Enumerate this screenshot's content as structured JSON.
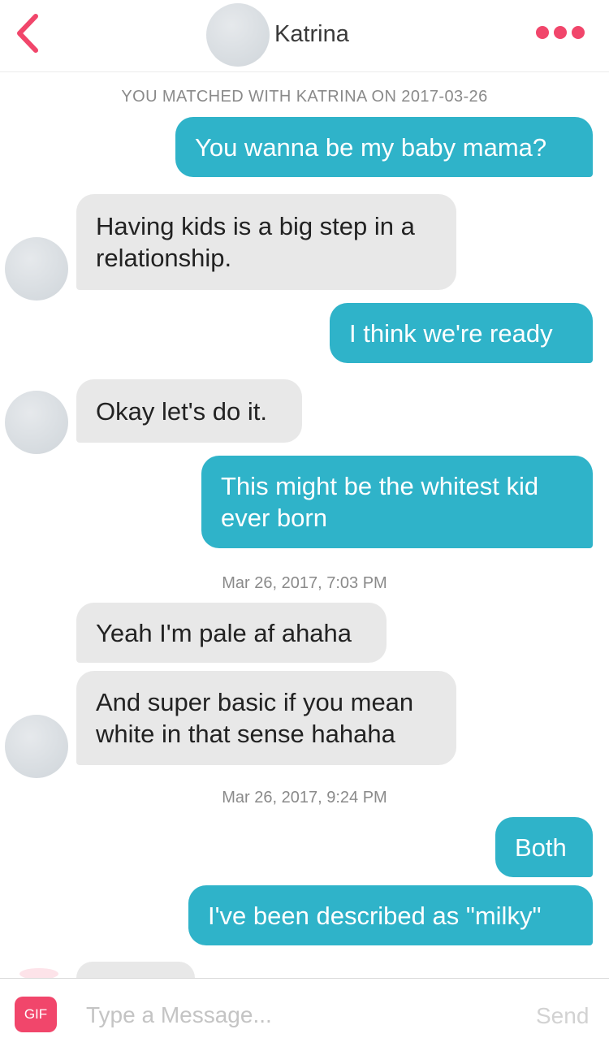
{
  "header": {
    "name": "Katrina"
  },
  "match_note": "YOU MATCHED WITH KATRINA ON 2017-03-26",
  "messages": [
    {
      "from": "me",
      "text": "You wanna be my baby mama?"
    },
    {
      "from": "them",
      "text": "Having kids is a big step in a relationship."
    },
    {
      "from": "me",
      "text": "I think we're ready"
    },
    {
      "from": "them",
      "text": "Okay let's do it."
    },
    {
      "from": "me",
      "text": "This might be the whitest kid ever born"
    },
    {
      "from": "them",
      "text": "Yeah I'm pale af ahaha"
    },
    {
      "from": "them",
      "text": "And super basic if you mean white in that sense hahaha"
    },
    {
      "from": "me",
      "text": "Both"
    },
    {
      "from": "me",
      "text": "I've been described as \"milky\""
    }
  ],
  "timestamps": [
    "Mar 26, 2017, 7:03 PM",
    "Mar 26, 2017, 9:24 PM"
  ],
  "composer": {
    "gif_label": "GIF",
    "placeholder": "Type a Message...",
    "send_label": "Send"
  },
  "colors": {
    "accent": "#f1466b",
    "outgoing_bubble": "#2fb3c9",
    "incoming_bubble": "#e8e8e8"
  }
}
